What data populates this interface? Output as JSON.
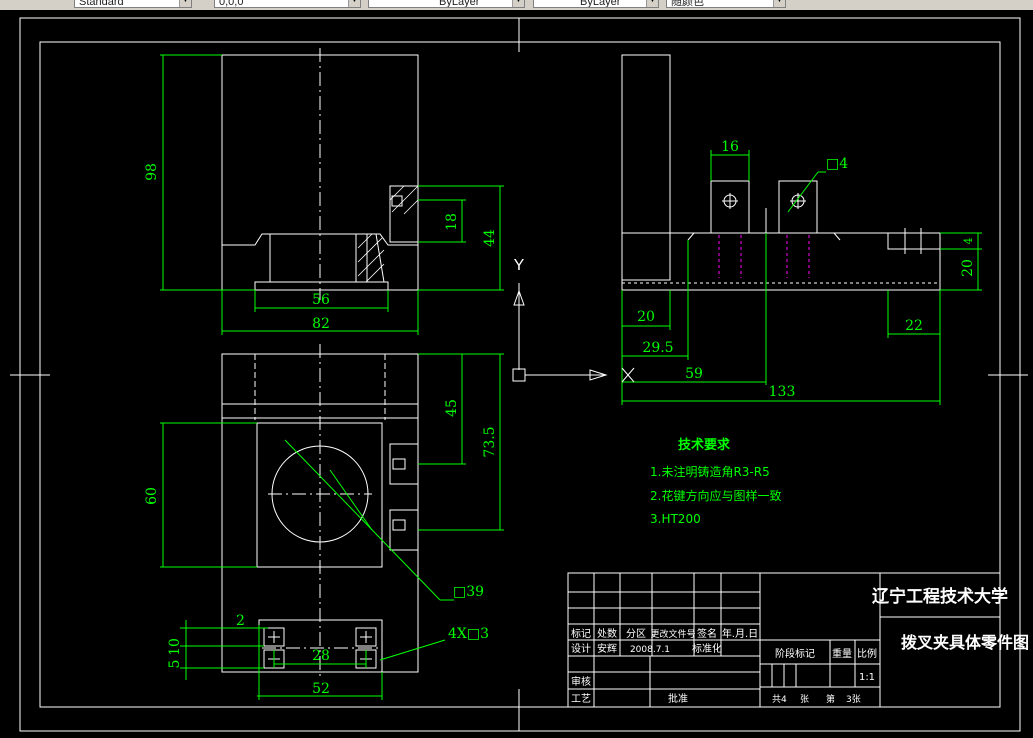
{
  "toolbar": {
    "style_value": "Standard",
    "color_value": "0,0,0",
    "layer_value": "ByLayer",
    "linetype_value": "ByLayer",
    "plot_value": "随颜色"
  },
  "dimensions": {
    "d98": "98",
    "d56": "56",
    "d82": "82",
    "d18": "18",
    "d44": "44",
    "d45": "45",
    "d73_5": "73.5",
    "d60": "60",
    "d39": "□39",
    "d2": "2",
    "d4x3": "4X□3",
    "d5": "5",
    "d10": "10",
    "d28": "28",
    "d52": "52",
    "d16": "16",
    "d4sq": "□4",
    "d4": "4",
    "d20v": "20",
    "d20h": "20",
    "d22": "22",
    "d29_5": "29.5",
    "d59": "59",
    "d133": "133"
  },
  "ucs": {
    "y_label": "Y",
    "x_label": "X"
  },
  "notes": {
    "title": "技术要求",
    "items": [
      "1.未注明铸造角R3-R5",
      "2.花键方向应与图样一致",
      "3.HT200"
    ]
  },
  "title_block": {
    "school": "辽宁工程技术大学",
    "drawing_name": "拨叉夹具体零件图",
    "row_headers": [
      "标记",
      "处数",
      "分区",
      "更改文件号",
      "签名",
      "年.月.日"
    ],
    "design_row": [
      "设计",
      "安辉",
      "2008.7.1",
      "标准化"
    ],
    "review_label": "审核",
    "process_label": "工艺",
    "approve_label": "批准",
    "stage_headers": [
      "阶段标记",
      "重量",
      "比例"
    ],
    "scale": "1:1",
    "sheet_info": [
      "共4",
      "张",
      "第",
      "3张"
    ]
  }
}
